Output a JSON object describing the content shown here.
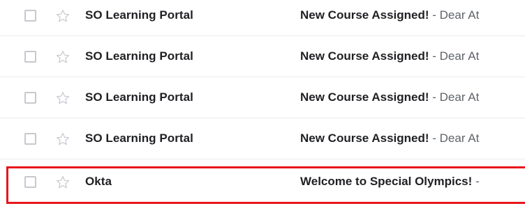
{
  "emails": [
    {
      "sender": "SO Learning Portal",
      "subject": "New Course Assigned!",
      "separator": " - ",
      "snippet": "Dear At"
    },
    {
      "sender": "SO Learning Portal",
      "subject": "New Course Assigned!",
      "separator": " - ",
      "snippet": "Dear At"
    },
    {
      "sender": "SO Learning Portal",
      "subject": "New Course Assigned!",
      "separator": " - ",
      "snippet": "Dear At"
    },
    {
      "sender": "SO Learning Portal",
      "subject": "New Course Assigned!",
      "separator": " - ",
      "snippet": "Dear At"
    },
    {
      "sender": "Okta",
      "subject": "Welcome to Special Olympics!",
      "separator": " -",
      "snippet": "",
      "highlighted": true
    }
  ],
  "icons": {
    "checkbox": "checkbox-icon",
    "star": "star-outline-icon"
  },
  "colors": {
    "highlight_border": "#e8161b",
    "text_primary": "#202124",
    "text_secondary": "#5f6368",
    "row_divider": "#e8eaed",
    "icon_gray": "#c5c9cf"
  }
}
